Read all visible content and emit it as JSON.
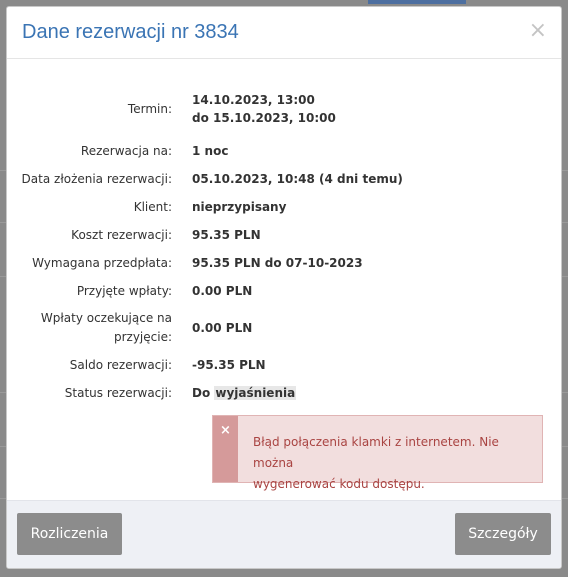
{
  "modal": {
    "title": "Dane rezerwacji nr 3834",
    "close_symbol": "×"
  },
  "details": {
    "termin_label": "Termin:",
    "termin_from": "14.10.2023, 13:00",
    "termin_to": "do 15.10.2023, 10:00",
    "reservation_for_label": "Rezerwacja na:",
    "reservation_for_value": "1 noc",
    "created_label": "Data złożenia rezerwacji:",
    "created_value": "05.10.2023, 10:48 (4 dni temu)",
    "client_label": "Klient:",
    "client_value": "nieprzypisany",
    "cost_label": "Koszt rezerwacji:",
    "cost_value": "95.35 PLN",
    "deposit_label": "Wymagana przedpłata:",
    "deposit_value": "95.35 PLN do 07-10-2023",
    "accepted_payments_label": "Przyjęte wpłaty:",
    "accepted_payments_value": "0.00 PLN",
    "pending_payments_label_1": "Wpłaty oczekujące na",
    "pending_payments_label_2": "przyjęcie:",
    "pending_payments_value": "0.00 PLN",
    "balance_label": "Saldo rezerwacji:",
    "balance_value": "-95.35 PLN",
    "status_label": "Status rezerwacji:",
    "status_prefix": "Do ",
    "status_highlight": "wyjaśnienia"
  },
  "alert": {
    "close_symbol": "×",
    "message_line1": "Błąd połączenia klamki z internetem. Nie można",
    "message_line2": "wygenerować kodu dostępu."
  },
  "footer": {
    "settlements_label": "Rozliczenia",
    "details_label": "Szczegóły"
  },
  "colors": {
    "title": "#3a74b4",
    "button": "#8c8c8c",
    "alert_bg": "#f2dede",
    "alert_text": "#a94442",
    "alert_strip": "#d59a9a",
    "footer_bg": "#eef0f5"
  }
}
